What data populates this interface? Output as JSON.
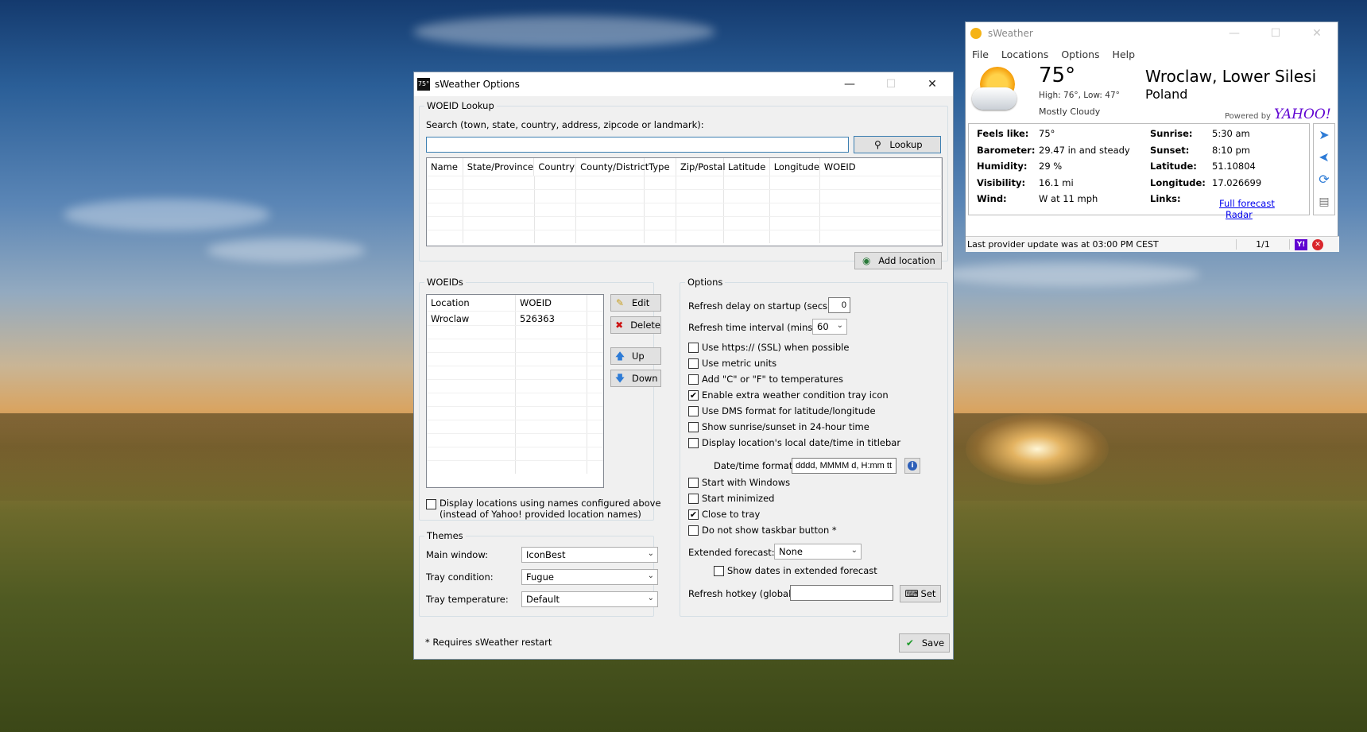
{
  "options_window": {
    "title": "sWeather Options",
    "icon_text": "75°",
    "woeid_lookup": {
      "legend": "WOEID Lookup",
      "search_label": "Search (town, state, country, address, zipcode or landmark):",
      "search_value": "",
      "lookup_button": "Lookup",
      "columns": [
        "Name",
        "State/Province",
        "Country",
        "County/District",
        "Type",
        "Zip/Postal",
        "Latitude",
        "Longitude",
        "WOEID"
      ],
      "add_location_button": "Add location"
    },
    "woeids": {
      "legend": "WOEIDs",
      "columns": [
        "Location",
        "WOEID"
      ],
      "rows": [
        [
          "Wroclaw",
          "526363"
        ]
      ],
      "edit_button": "Edit",
      "delete_button": "Delete",
      "up_button": "Up",
      "down_button": "Down",
      "display_names_checkbox": "Display locations using names configured above",
      "display_names_checkbox_line2": "(instead of Yahoo! provided location names)"
    },
    "themes": {
      "legend": "Themes",
      "main_window_label": "Main window:",
      "main_window_value": "IconBest",
      "tray_condition_label": "Tray condition:",
      "tray_condition_value": "Fugue",
      "tray_temperature_label": "Tray temperature:",
      "tray_temperature_value": "Default"
    },
    "options": {
      "legend": "Options",
      "refresh_delay_label": "Refresh delay on startup (secs):",
      "refresh_delay_value": "0",
      "refresh_interval_label": "Refresh time interval (mins):",
      "refresh_interval_value": "60",
      "checkboxes": [
        {
          "label": "Use https:// (SSL) when possible",
          "checked": false
        },
        {
          "label": "Use metric units",
          "checked": false
        },
        {
          "label": "Add \"C\" or \"F\" to temperatures",
          "checked": false
        },
        {
          "label": "Enable extra weather condition tray icon",
          "checked": true
        },
        {
          "label": "Use DMS format for latitude/longitude",
          "checked": false
        },
        {
          "label": "Show sunrise/sunset in 24-hour time",
          "checked": false
        },
        {
          "label": "Display location's local date/time in titlebar",
          "checked": false
        }
      ],
      "datetime_format_label": "Date/time format:",
      "datetime_format_value": "dddd, MMMM d, H:mm tt",
      "checkboxes2": [
        {
          "label": "Start with Windows",
          "checked": false
        },
        {
          "label": "Start minimized",
          "checked": false
        },
        {
          "label": "Close to tray",
          "checked": true
        },
        {
          "label": "Do not show taskbar button *",
          "checked": false
        }
      ],
      "extended_forecast_label": "Extended forecast:",
      "extended_forecast_value": "None",
      "show_dates_label": "Show dates in extended forecast",
      "hotkey_label": "Refresh hotkey (global):",
      "hotkey_value": "",
      "set_button": "Set"
    },
    "footer_note": "* Requires sWeather restart",
    "save_button": "Save"
  },
  "weather_window": {
    "title": "sWeather",
    "menu": [
      "File",
      "Locations",
      "Options",
      "Help"
    ],
    "temperature": "75°",
    "high_low": "High: 76°, Low: 47°",
    "condition": "Mostly Cloudy",
    "location_line1": "Wroclaw, Lower Silesi",
    "location_line2": "Poland",
    "powered_by": "Powered by",
    "yahoo": "YAHOO!",
    "details_left": [
      {
        "label": "Feels like:",
        "value": "75°"
      },
      {
        "label": "Barometer:",
        "value": "29.47 in and steady"
      },
      {
        "label": "Humidity:",
        "value": "29 %"
      },
      {
        "label": "Visibility:",
        "value": "16.1 mi"
      },
      {
        "label": "Wind:",
        "value": "W at 11 mph"
      }
    ],
    "details_right": [
      {
        "label": "Sunrise:",
        "value": "5:30 am"
      },
      {
        "label": "Sunset:",
        "value": "8:10 pm"
      },
      {
        "label": "Latitude:",
        "value": "51.10804"
      },
      {
        "label": "Longitude:",
        "value": "17.026699"
      },
      {
        "label": "Links:",
        "value": ""
      }
    ],
    "link_full_forecast": "Full forecast",
    "link_radar": "Radar",
    "status_text": "Last provider update was at 03:00 PM CEST",
    "page_indicator": "1/1"
  }
}
